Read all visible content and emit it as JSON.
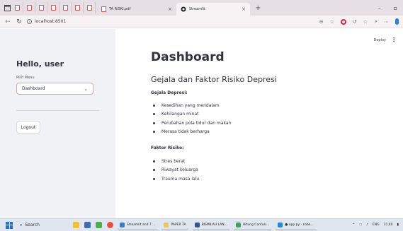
{
  "browser": {
    "tabs": [
      {
        "title": "TA RISKI.pdf",
        "icon": "pdf-icon"
      },
      {
        "title": "Streamlit",
        "icon": "streamlit-icon",
        "active": true
      }
    ],
    "url": "localhost:8501",
    "new_tab": "+",
    "close_glyph": "×"
  },
  "app": {
    "toolbar": {
      "deploy_label": "Deploy",
      "menu_glyph": "⋮"
    },
    "sidebar": {
      "greeting": "Hello, user",
      "menu_label": "Pilih Menu",
      "selected_menu": "Dashboard",
      "logout_label": "Logout"
    },
    "main": {
      "title": "Dashboard",
      "subtitle": "Gejala dan Faktor Risiko Depresi",
      "symptoms_heading": "Gejala Depresi:",
      "symptoms": [
        "Kesedihan yang mendalam",
        "Kehilangan minat",
        "Perubahan pola tidur dan makan",
        "Merasa tidak berharga"
      ],
      "risk_heading": "Faktor Risiko:",
      "risks": [
        "Stres berat",
        "Riwayat keluarga",
        "Trauma masa lalu"
      ]
    }
  },
  "taskbar": {
    "search_label": "Search",
    "apps": [
      {
        "label": "Streamlit and 7 ...",
        "color": "#2f7de1"
      },
      {
        "label": "PAPER TA",
        "color": "#f5c542"
      },
      {
        "label": "BISMILAH LAN...",
        "color": "#2b579a"
      },
      {
        "label": "Hitung Confusi...",
        "color": "#34a853"
      },
      {
        "label": "● app.py - coba...",
        "color": "#1e88e5"
      }
    ],
    "tray": {
      "lang": "ENG",
      "time": "11.40"
    }
  },
  "colors": {
    "sidebar_bg": "#f0f2f6",
    "select_border": "#e3a3a8",
    "text": "#31333f"
  }
}
